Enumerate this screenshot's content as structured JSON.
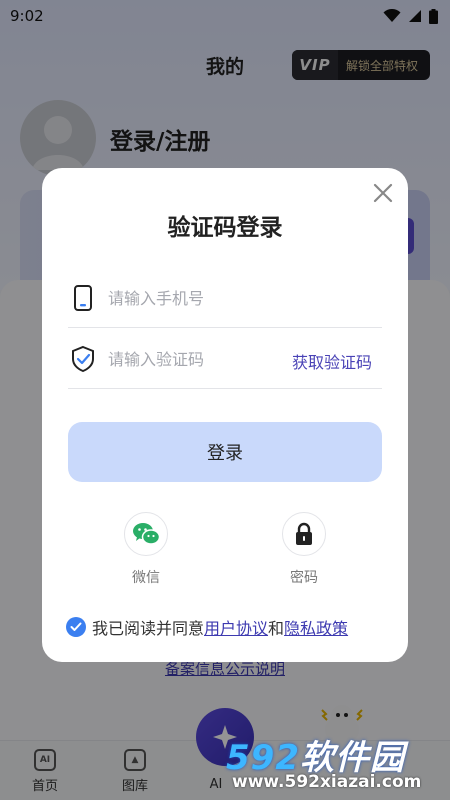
{
  "status_bar": {
    "time": "9:02"
  },
  "profile_page": {
    "title": "我的",
    "vip_badge": {
      "logo": "VIP",
      "text": "解锁全部特权"
    },
    "login_register": "登录/注册",
    "beian_link": "备案信息公示说明"
  },
  "tab_bar": {
    "tabs": [
      {
        "label": "首页",
        "icon": "home-ai-icon"
      },
      {
        "label": "图库",
        "icon": "gallery-icon"
      },
      {
        "label": "AI",
        "icon": "ai-create-icon"
      }
    ]
  },
  "dialog": {
    "title": "验证码登录",
    "phone_placeholder": "请输入手机号",
    "code_placeholder": "请输入验证码",
    "get_code": "获取验证码",
    "login_button": "登录",
    "alt_logins": [
      {
        "label": "微信",
        "icon": "wechat-icon"
      },
      {
        "label": "密码",
        "icon": "lock-icon"
      }
    ],
    "agreement": {
      "checked": true,
      "prefix": "我已阅读并同意",
      "user_agreement": "用户协议",
      "conjunction": "和",
      "privacy_policy": "隐私政策"
    }
  },
  "watermark": {
    "brand": "592软件园",
    "brand_digits": "592",
    "brand_text": "软件园",
    "url": "www.592xiazai.com"
  },
  "colors": {
    "accent_purple": "#4a43b6",
    "login_button_bg": "#c9d9fb",
    "checkbox_blue": "#3b7ff0",
    "wechat_green": "#2aae67",
    "overlay": "rgba(0,0,0,0.42)"
  }
}
